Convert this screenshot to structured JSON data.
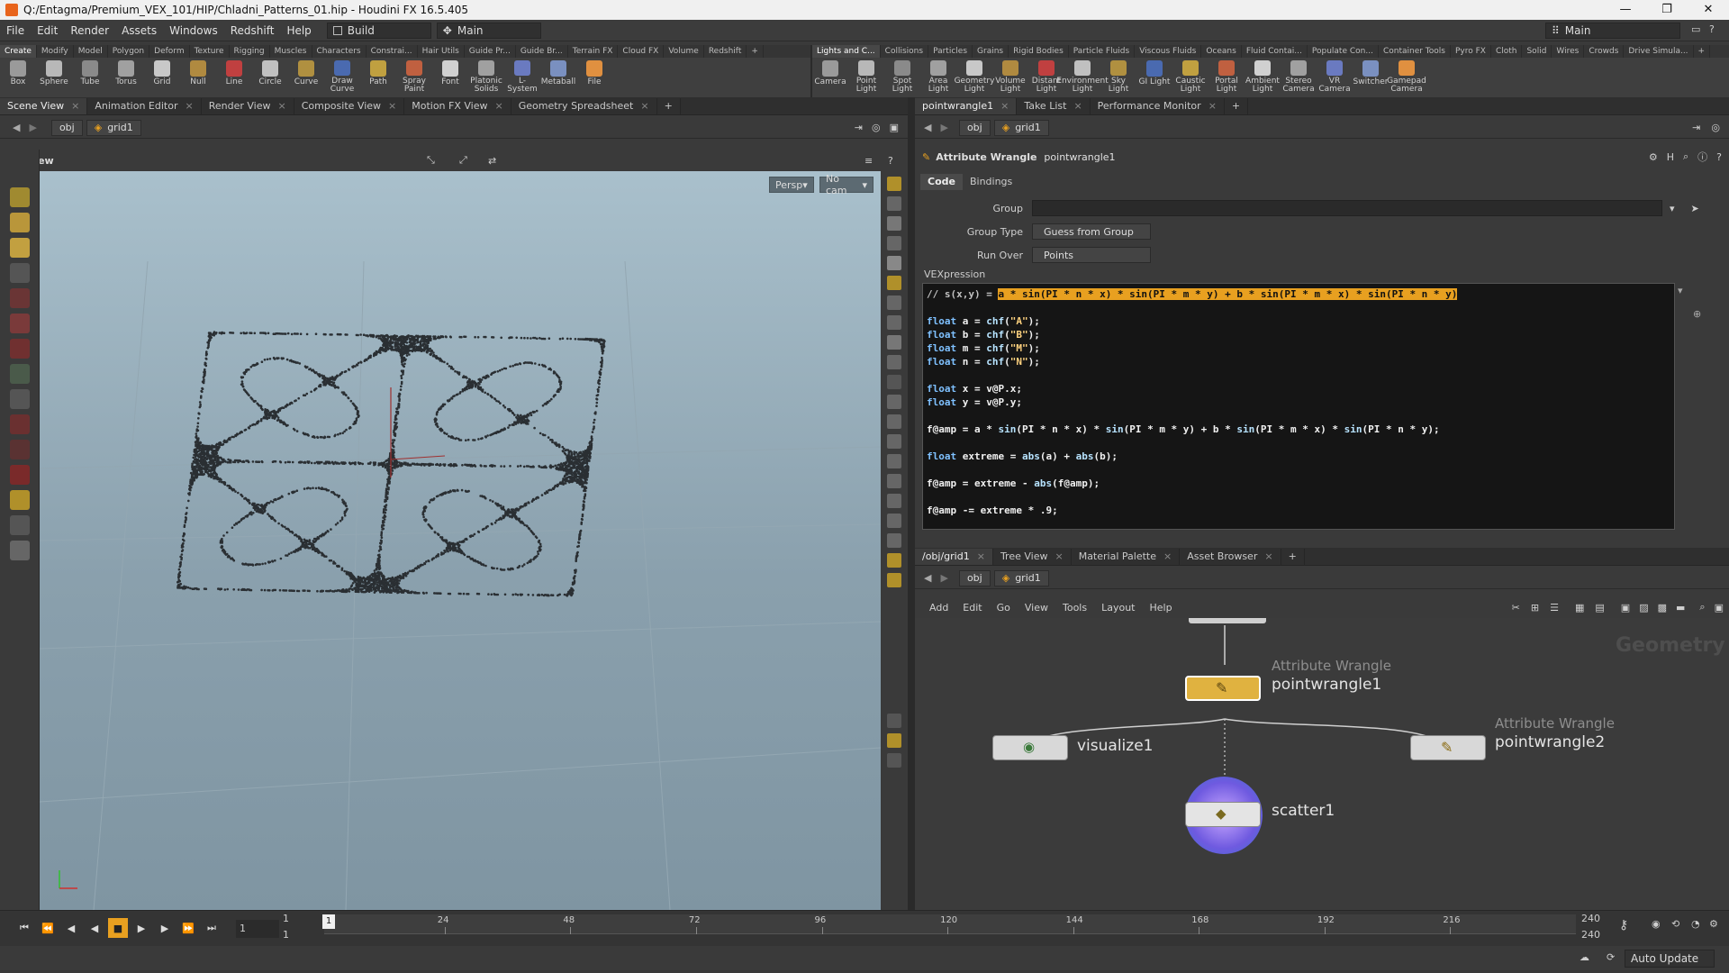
{
  "window": {
    "title": "Q:/Entagma/Premium_VEX_101/HIP/Chladni_Patterns_01.hip - Houdini FX 16.5.405",
    "buttons": [
      "—",
      "❐",
      "✕"
    ]
  },
  "menubar": {
    "items": [
      "File",
      "Edit",
      "Render",
      "Assets",
      "Windows",
      "Redshift",
      "Help"
    ],
    "desktop_left": "Build",
    "desktop_mid": "Main",
    "desktop_right": "Main"
  },
  "shelf_left": {
    "tabs": [
      "Create",
      "Modify",
      "Model",
      "Polygon",
      "Deform",
      "Texture",
      "Rigging",
      "Muscles",
      "Characters",
      "Constrai...",
      "Hair Utils",
      "Guide Pr...",
      "Guide Br...",
      "Terrain FX",
      "Cloud FX",
      "Volume",
      "Redshift"
    ],
    "tools": [
      "Box",
      "Sphere",
      "Tube",
      "Torus",
      "Grid",
      "Null",
      "Line",
      "Circle",
      "Curve",
      "Draw Curve",
      "Path",
      "Spray Paint",
      "Font",
      "Platonic Solids",
      "L-System",
      "Metaball",
      "File"
    ]
  },
  "shelf_right": {
    "tabs": [
      "Lights and C...",
      "Collisions",
      "Particles",
      "Grains",
      "Rigid Bodies",
      "Particle Fluids",
      "Viscous Fluids",
      "Oceans",
      "Fluid Contai...",
      "Populate Con...",
      "Container Tools",
      "Pyro FX",
      "Cloth",
      "Solid",
      "Wires",
      "Crowds",
      "Drive Simula..."
    ],
    "tools": [
      "Camera",
      "Point Light",
      "Spot Light",
      "Area Light",
      "Geometry Light",
      "Volume Light",
      "Distant Light",
      "Environment Light",
      "Sky Light",
      "GI Light",
      "Caustic Light",
      "Portal Light",
      "Ambient Light",
      "Stereo Camera",
      "VR Camera",
      "Switcher",
      "Gamepad Camera"
    ]
  },
  "left_pane": {
    "tabs": [
      "Scene View",
      "Animation Editor",
      "Render View",
      "Composite View",
      "Motion FX View",
      "Geometry Spreadsheet"
    ],
    "path": [
      "obj",
      "grid1"
    ],
    "view_label": "View",
    "persp": "Persp",
    "cam": "No cam"
  },
  "param_pane": {
    "tabs": [
      "pointwrangle1",
      "Take List",
      "Performance Monitor"
    ],
    "path": [
      "obj",
      "grid1"
    ],
    "node_type": "Attribute Wrangle",
    "node_name": "pointwrangle1",
    "subtabs": [
      "Code",
      "Bindings"
    ],
    "group_label": "Group",
    "group_value": "",
    "group_type_label": "Group Type",
    "group_type_value": "Guess from Group",
    "run_over_label": "Run Over",
    "run_over_value": "Points",
    "vex_label": "VEXpression",
    "code_lines": [
      "// s(x,y) = a * sin(PI * n * x) * sin(PI * m * y) + b * sin(PI * m * x) * sin(PI * n * y)",
      "",
      "float a = chf(\"A\");",
      "float b = chf(\"B\");",
      "float m = chf(\"M\");",
      "float n = chf(\"N\");",
      "",
      "float x = v@P.x;",
      "float y = v@P.y;",
      "",
      "f@amp = a * sin(PI * n * x) * sin(PI * m * y) + b * sin(PI * m * x) * sin(PI * n * y);",
      "",
      "float extreme = abs(a) + abs(b);",
      "",
      "f@amp = extreme - abs(f@amp);",
      "",
      "f@amp -= extreme * .9;"
    ]
  },
  "network_pane": {
    "tabs": [
      "/obj/grid1",
      "Tree View",
      "Material Palette",
      "Asset Browser"
    ],
    "path": [
      "obj",
      "grid1"
    ],
    "menu": [
      "Add",
      "Edit",
      "Go",
      "View",
      "Tools",
      "Layout",
      "Help"
    ],
    "context_label": "Geometry",
    "nodes": [
      {
        "type": "Attribute Wrangle",
        "name": "pointwrangle1"
      },
      {
        "type": "",
        "name": "visualize1"
      },
      {
        "type": "Attribute Wrangle",
        "name": "pointwrangle2"
      },
      {
        "type": "",
        "name": "scatter1"
      }
    ]
  },
  "timeline": {
    "current_frame": "1",
    "start": "1",
    "start2": "1",
    "ticks": [
      "24",
      "48",
      "72",
      "96",
      "120",
      "144",
      "168",
      "192",
      "216"
    ],
    "marker": "1",
    "end": "240",
    "end2": "240",
    "auto_update": "Auto Update"
  },
  "colors": {
    "accent": "#e8a020",
    "viewport_top": "#a9c0cc",
    "viewport_bottom": "#7f95a2",
    "scatter_selected": "#3f6fd0"
  }
}
